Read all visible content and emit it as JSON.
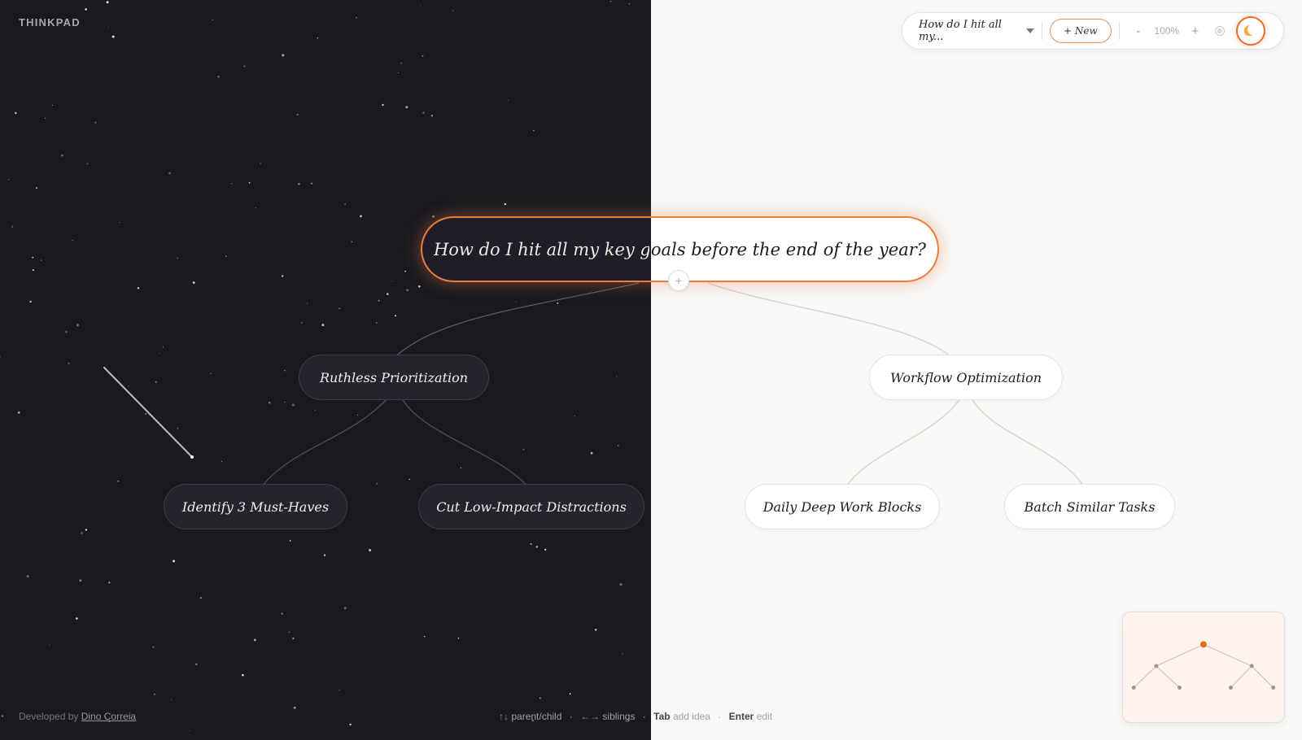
{
  "app": {
    "brand": "THINKPAD"
  },
  "toolbar": {
    "map_title": "How do I hit all my...",
    "new_label": "+ New",
    "zoom_out": "-",
    "zoom_level": "100%",
    "zoom_in": "+"
  },
  "mindmap": {
    "root": "How do I hit all my key goals before the end of the year?",
    "add_child_label": "+",
    "branches": [
      {
        "label": "Ruthless Prioritization",
        "children": [
          "Identify 3 Must-Haves",
          "Cut Low-Impact Distractions"
        ]
      },
      {
        "label": "Workflow Optimization",
        "children": [
          "Daily Deep Work Blocks",
          "Batch Similar Tasks"
        ]
      }
    ]
  },
  "footer": {
    "credit_prefix": "Developed by",
    "credit_name": "Dino Correia",
    "hints": [
      {
        "keys": "↑↓",
        "desc": "parent/child"
      },
      {
        "keys": "←→",
        "desc": "siblings"
      },
      {
        "keys": "Tab",
        "desc": "add idea"
      },
      {
        "keys": "Enter",
        "desc": "edit"
      }
    ]
  },
  "colors": {
    "dark_bg": "#1a1920",
    "light_bg": "#f8f8f7",
    "accent": "#ee7d3c"
  }
}
